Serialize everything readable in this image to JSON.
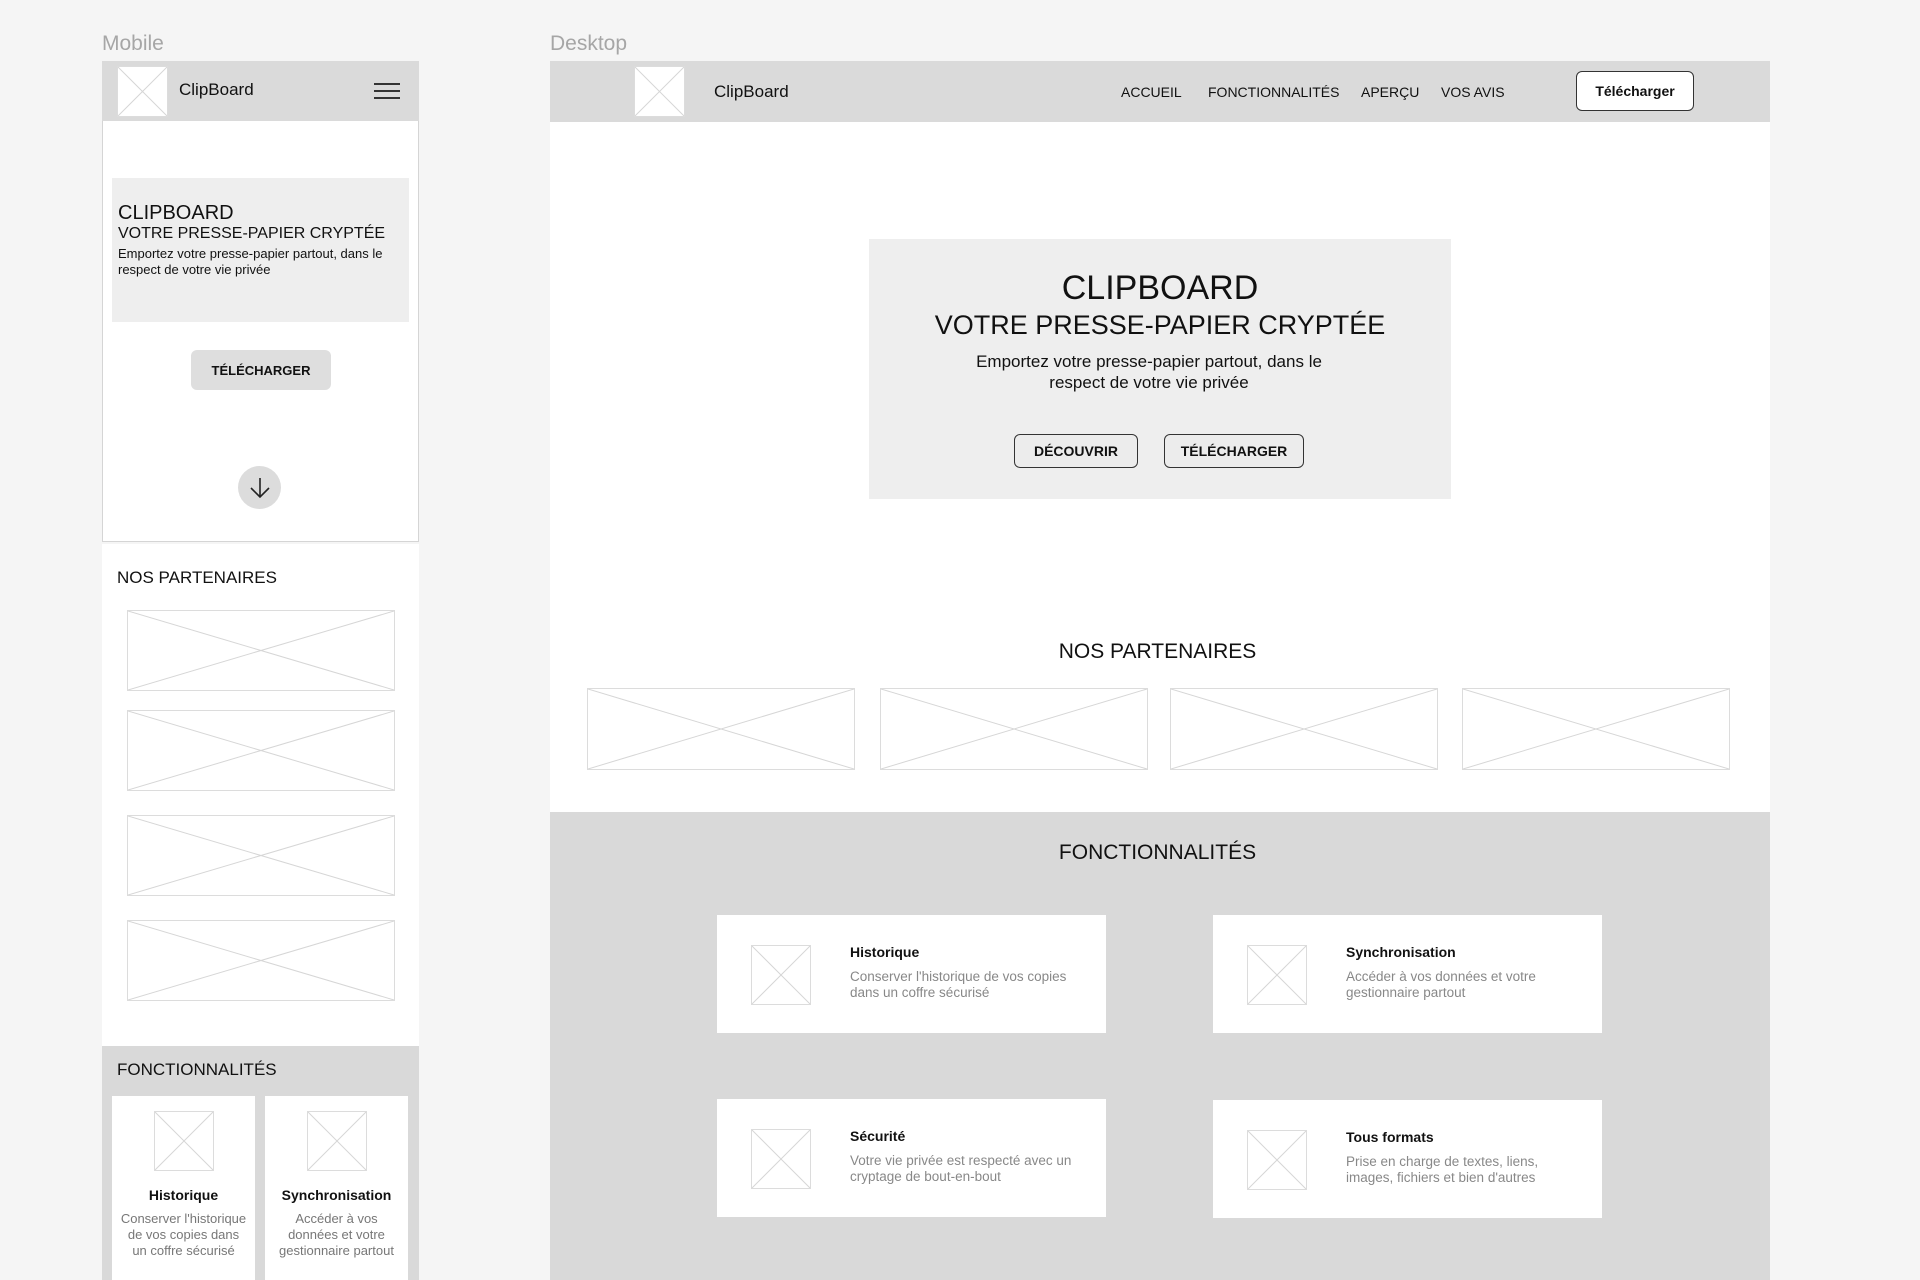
{
  "labels": {
    "mobile": "Mobile",
    "desktop": "Desktop"
  },
  "brand": "ClipBoard",
  "hero": {
    "title": "CLIPBOARD",
    "subtitle": "VOTRE PRESSE-PAPIER CRYPTÉE",
    "description": "Emportez votre presse-papier partout, dans le respect de votre vie privée",
    "discover_label": "DÉCOUVRIR",
    "download_label": "TÉLÉCHARGER"
  },
  "nav": {
    "items": [
      "ACCUEIL",
      "FONCTIONNALITÉS",
      "APERÇU",
      "VOS AVIS"
    ],
    "download_label": "Télécharger"
  },
  "partners": {
    "title": "NOS PARTENAIRES"
  },
  "features": {
    "title": "FONCTIONNALITÉS",
    "items": [
      {
        "title": "Historique",
        "description": "Conserver l'historique de vos copies dans un coffre sécurisé"
      },
      {
        "title": "Synchronisation",
        "description": "Accéder à vos données et votre gestionnaire partout"
      },
      {
        "title": "Sécurité",
        "description": "Votre vie privée est respecté avec un cryptage de bout-en-bout"
      },
      {
        "title": "Tous formats",
        "description": "Prise en charge de textes, liens, images, fichiers et bien d'autres"
      }
    ]
  },
  "icons": {
    "menu": "hamburger-menu-icon",
    "scroll": "arrow-down-icon",
    "placeholder": "image-placeholder-icon"
  },
  "colors": {
    "background": "#f5f5f5",
    "header": "#dadada",
    "hero": "#eeeeee",
    "features": "#d9d9d9",
    "frame_label": "#a6a6a6"
  }
}
